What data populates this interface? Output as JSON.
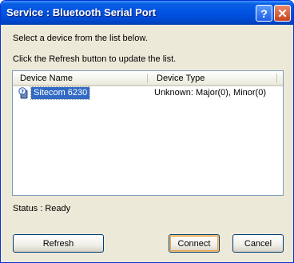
{
  "window": {
    "title": "Service : Bluetooth Serial Port",
    "help_glyph": "?",
    "close_glyph": "✕"
  },
  "instructions": {
    "line1": "Select a device from the list below.",
    "line2": "Click the Refresh button to update the list."
  },
  "device_list": {
    "columns": [
      "Device Name",
      "Device Type"
    ],
    "rows": [
      {
        "name": "Sitecom 6230",
        "type": "Unknown: Major(0), Minor(0)",
        "icon": "bluetooth-device-unknown-icon",
        "selected": true
      }
    ]
  },
  "status": {
    "text": "Status : Ready"
  },
  "buttons": {
    "refresh": "Refresh",
    "connect": "Connect",
    "cancel": "Cancel"
  },
  "colors": {
    "titlebar": "#0054e3",
    "selection": "#316ac5",
    "dialog_bg": "#ece9d8"
  }
}
